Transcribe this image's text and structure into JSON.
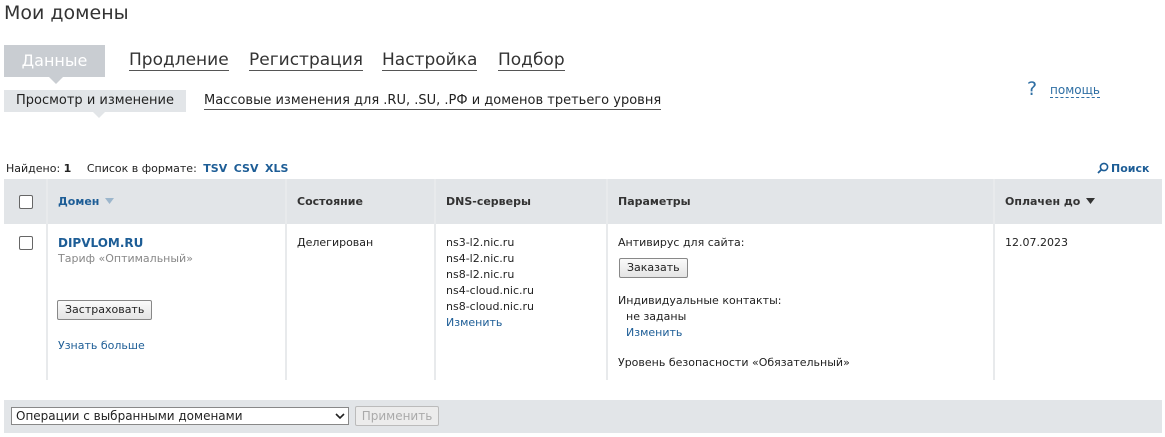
{
  "page": {
    "title": "Мои домены"
  },
  "tabs": {
    "active": "Данные",
    "items": [
      "Продление",
      "Регистрация",
      "Настройка",
      "Подбор"
    ]
  },
  "subtabs": {
    "active": "Просмотр и изменение",
    "other": "Массовые изменения для .RU, .SU, .РФ и доменов третьего уровня"
  },
  "help": {
    "label": "помощь"
  },
  "summary": {
    "found_label": "Найдено:",
    "found_count": "1",
    "format_label": "Список в формате:",
    "formats": [
      "TSV",
      "CSV",
      "XLS"
    ],
    "search_label": "Поиск"
  },
  "table": {
    "headers": {
      "domain": "Домен",
      "status": "Состояние",
      "dns": "DNS-серверы",
      "params": "Параметры",
      "paid_until": "Оплачен до"
    },
    "rows": [
      {
        "domain": "DIPVLOM.RU",
        "tariff": "Тариф «Оптимальный»",
        "insure_button": "Застраховать",
        "learn_more": "Узнать больше",
        "status": "Делегирован",
        "dns_servers": [
          "ns3-l2.nic.ru",
          "ns4-l2.nic.ru",
          "ns8-l2.nic.ru",
          "ns4-cloud.nic.ru",
          "ns8-cloud.nic.ru"
        ],
        "dns_change": "Изменить",
        "antivirus_label": "Антивирус для сайта:",
        "order_button": "Заказать",
        "contacts_label": "Индивидуальные контакты:",
        "contacts_value": "не заданы",
        "contacts_change": "Изменить",
        "security_level": "Уровень безопасности «Обязательный»",
        "paid_until": "12.07.2023"
      }
    ]
  },
  "footer": {
    "operations_select": "Операции с выбранными доменами",
    "apply_button": "Применить"
  },
  "colors": {
    "link": "#1d5d96",
    "header_bg": "#e2e5e8",
    "active_tab_bg": "#c9cdd2"
  }
}
